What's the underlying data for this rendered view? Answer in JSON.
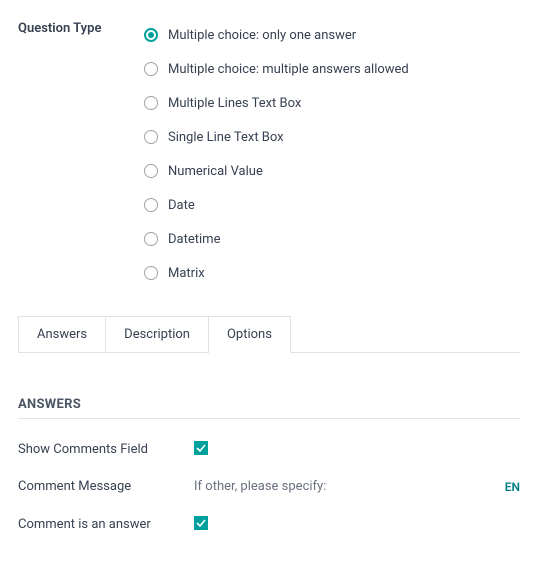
{
  "question_type_label": "Question Type",
  "types": [
    {
      "label": "Multiple choice: only one answer",
      "selected": true
    },
    {
      "label": "Multiple choice: multiple answers allowed",
      "selected": false
    },
    {
      "label": "Multiple Lines Text Box",
      "selected": false
    },
    {
      "label": "Single Line Text Box",
      "selected": false
    },
    {
      "label": "Numerical Value",
      "selected": false
    },
    {
      "label": "Date",
      "selected": false
    },
    {
      "label": "Datetime",
      "selected": false
    },
    {
      "label": "Matrix",
      "selected": false
    }
  ],
  "tabs": [
    {
      "label": "Answers",
      "active": false
    },
    {
      "label": "Description",
      "active": false
    },
    {
      "label": "Options",
      "active": true
    }
  ],
  "section_title": "ANSWERS",
  "show_comments_label": "Show Comments Field",
  "show_comments_checked": true,
  "comment_message_label": "Comment Message",
  "comment_message_value": "If other, please specify:",
  "comment_lang": "EN",
  "comment_is_answer_label": "Comment is an answer",
  "comment_is_answer_checked": true
}
